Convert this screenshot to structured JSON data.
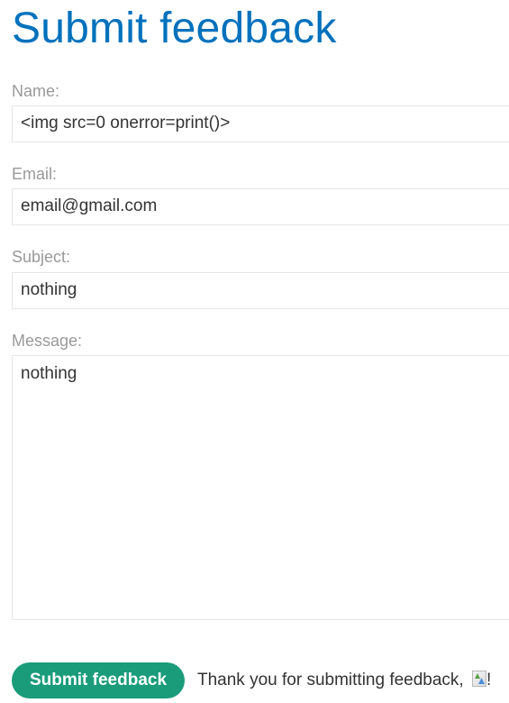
{
  "page": {
    "title": "Submit feedback"
  },
  "form": {
    "name": {
      "label": "Name:",
      "value": "<img src=0 onerror=print()>"
    },
    "email": {
      "label": "Email:",
      "value": "email@gmail.com"
    },
    "subject": {
      "label": "Subject:",
      "value": "nothing"
    },
    "message": {
      "label": "Message:",
      "value": "nothing"
    },
    "submit_label": "Submit feedback"
  },
  "confirmation": {
    "text": "Thank you for submitting feedback, ",
    "suffix": "!",
    "image_icon": "broken-image-icon"
  },
  "colors": {
    "heading": "#0071bc",
    "label": "#999999",
    "button": "#1a9c7b",
    "text": "#333333"
  }
}
